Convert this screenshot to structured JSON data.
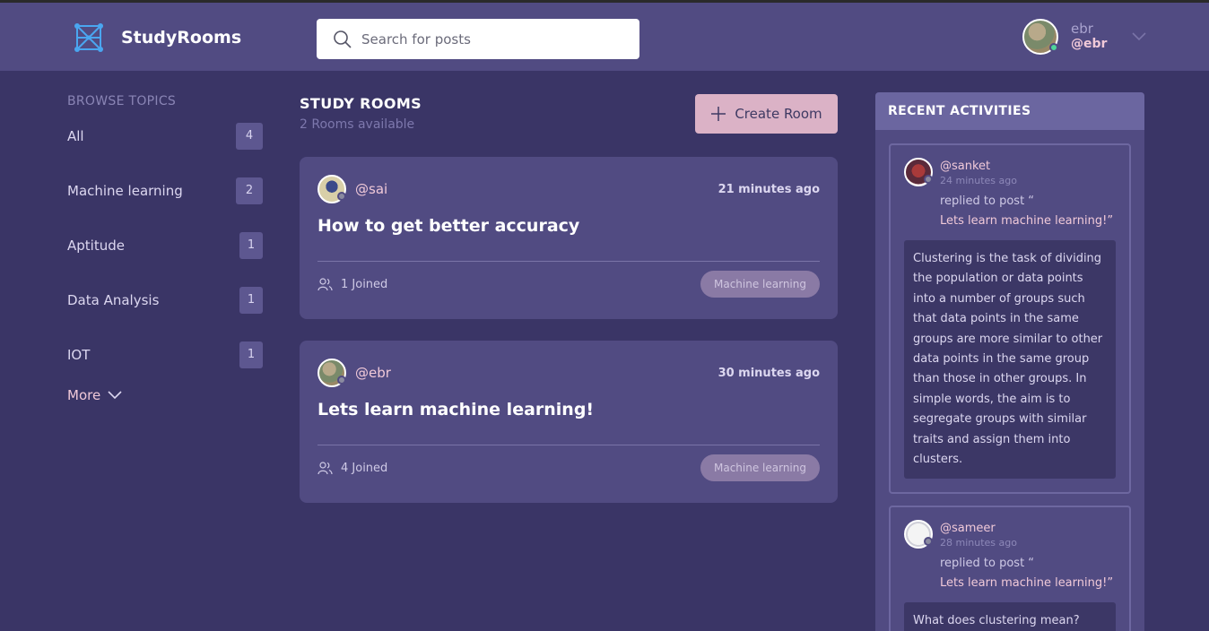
{
  "brand": {
    "name": "StudyRooms",
    "icon": "network-logo-icon"
  },
  "search": {
    "placeholder": "Search for posts",
    "value": ""
  },
  "user": {
    "name": "ebr",
    "handle": "@ebr"
  },
  "sidebar": {
    "title": "BROWSE TOPICS",
    "topics": [
      {
        "label": "All",
        "count": "4"
      },
      {
        "label": "Machine learning",
        "count": "2"
      },
      {
        "label": "Aptitude",
        "count": "1"
      },
      {
        "label": "Data Analysis",
        "count": "1"
      },
      {
        "label": "IOT",
        "count": "1"
      }
    ],
    "more_label": "More"
  },
  "main": {
    "title": "STUDY ROOMS",
    "subtitle": "2 Rooms available",
    "create_label": "Create Room",
    "rooms": [
      {
        "host": "@sai",
        "time": "21 minutes ago",
        "title": "How to get better accuracy",
        "joined": "1 Joined",
        "topic": "Machine learning"
      },
      {
        "host": "@ebr",
        "time": "30 minutes ago",
        "title": "Lets learn machine learning!",
        "joined": "4 Joined",
        "topic": "Machine learning"
      }
    ]
  },
  "activity": {
    "title": "RECENT ACTIVITIES",
    "items": [
      {
        "user": "@sanket",
        "time": "24 minutes ago",
        "action": "replied to post “",
        "post": "Lets learn machine learning!”",
        "body": "Clustering is the task of dividing the population or data points into a number of groups such that data points in the same groups are more similar to other data points in the same group than those in other groups. In simple words, the aim is to segregate groups with similar traits and assign them into clusters."
      },
      {
        "user": "@sameer",
        "time": "28 minutes ago",
        "action": "replied to post “",
        "post": "Lets learn machine learning!”",
        "body": "What does clustering mean?"
      }
    ]
  },
  "colors": {
    "background": "#3a3566",
    "topbar": "#514b82",
    "accent_pink": "#dbb2c6",
    "online_status": "#4ed69a"
  }
}
